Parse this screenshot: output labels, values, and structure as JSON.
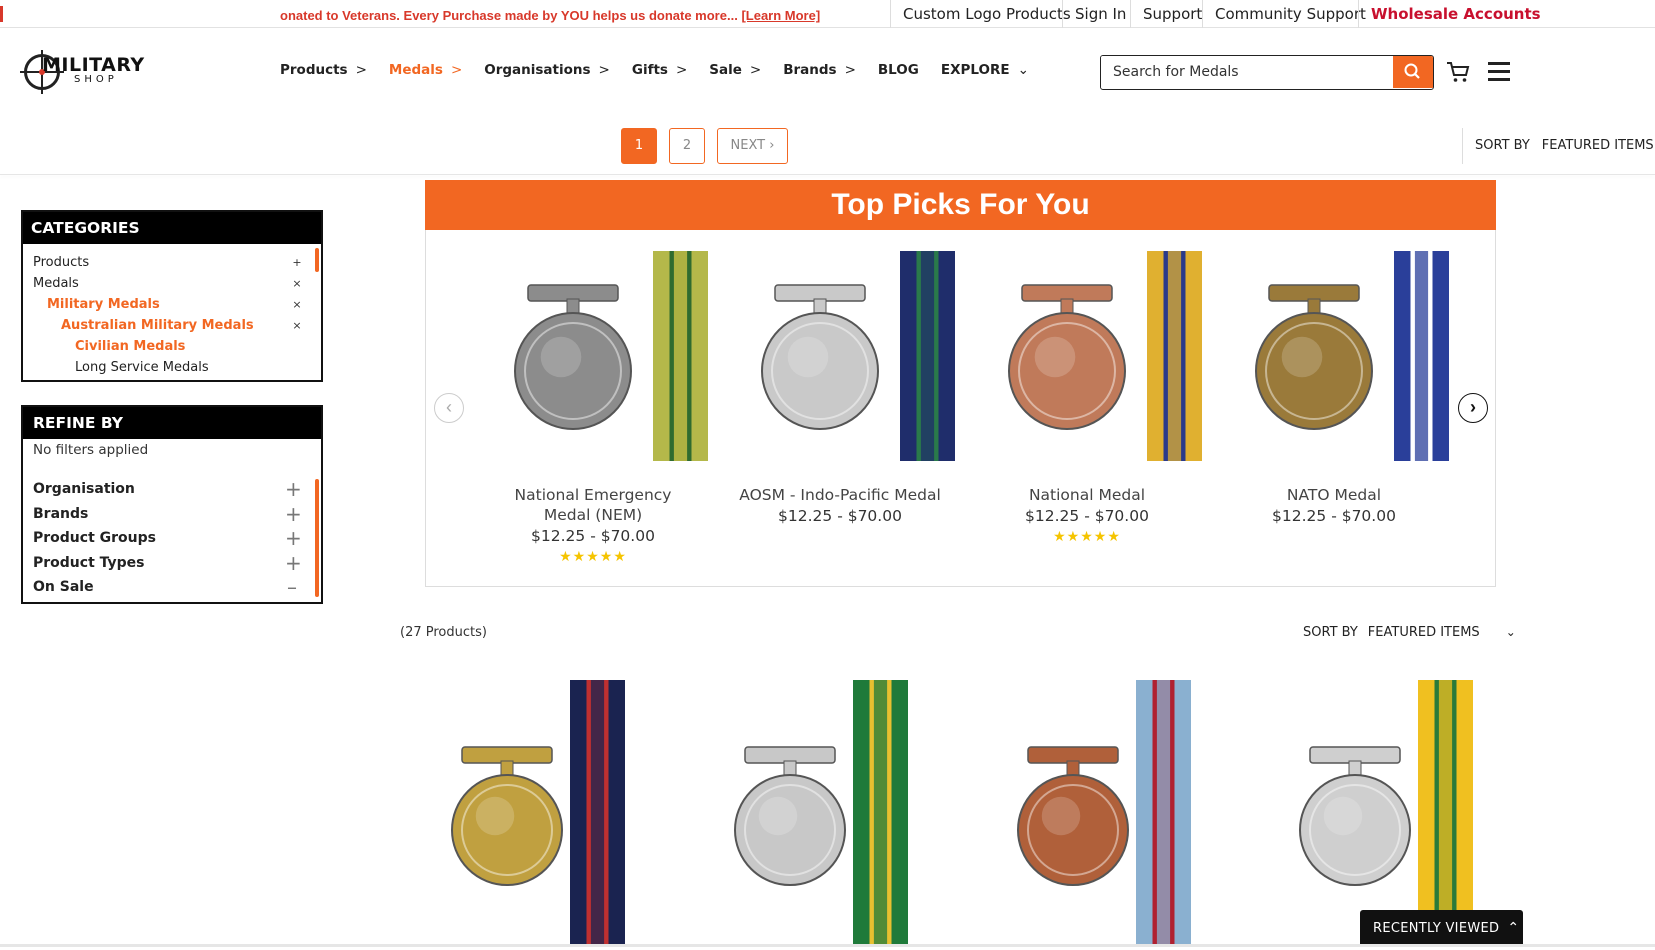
{
  "announcement": {
    "text": "onated to Veterans. Every Purchase made by YOU helps us donate more...",
    "link": "[Learn More]"
  },
  "top_links": [
    "Custom Logo Products",
    "Sign In",
    "Support",
    "Community Support",
    "Wholesale Accounts"
  ],
  "logo": {
    "line1": "MILITARY",
    "line2": "SHOP"
  },
  "nav": [
    {
      "label": "Products",
      "arrow": ">"
    },
    {
      "label": "Medals",
      "arrow": ">",
      "active": true
    },
    {
      "label": "Organisations",
      "arrow": ">"
    },
    {
      "label": "Gifts",
      "arrow": ">"
    },
    {
      "label": "Sale",
      "arrow": ">"
    },
    {
      "label": "Brands",
      "arrow": ">"
    },
    {
      "label": "BLOG",
      "arrow": ""
    },
    {
      "label": "EXPLORE",
      "arrow": "⌄"
    }
  ],
  "search": {
    "placeholder": "Search for Medals",
    "icon": "search-icon"
  },
  "pagination": {
    "pages": [
      "1",
      "2"
    ],
    "current": "1",
    "next": "NEXT"
  },
  "sort": {
    "label": "SORT BY",
    "value": "FEATURED ITEMS"
  },
  "categories": {
    "title": "CATEGORIES",
    "items": [
      {
        "label": "Products",
        "control": "+"
      },
      {
        "label": "Medals",
        "control": "×"
      },
      {
        "label": "Military Medals",
        "control": "×"
      },
      {
        "label": "Australian Military Medals",
        "control": "×"
      },
      {
        "label": "Civilian Medals",
        "control": ""
      },
      {
        "label": "Long Service Medals",
        "control": ""
      }
    ]
  },
  "refine": {
    "title": "REFINE BY",
    "status": "No filters applied",
    "filters": [
      {
        "label": "Organisation",
        "control": "+"
      },
      {
        "label": "Brands",
        "control": "+"
      },
      {
        "label": "Product Groups",
        "control": "+"
      },
      {
        "label": "Product Types",
        "control": "+"
      },
      {
        "label": "On Sale",
        "control": "–"
      }
    ]
  },
  "top_picks": {
    "title": "Top Picks For You",
    "products": [
      {
        "name": "National Emergency Medal (NEM)",
        "price": "$12.25 - $70.00",
        "stars": "★★★★★",
        "medal_color": "#8c8c8c",
        "ribbon": [
          "#b4b84a",
          "#2f6b2f",
          "#d8c84a"
        ]
      },
      {
        "name": "AOSM - Indo-Pacific Medal",
        "price": "$12.25 - $70.00",
        "stars": "",
        "medal_color": "#c9c9c9",
        "ribbon": [
          "#1f2d6b",
          "#2a7a4a",
          "#1f2d6b"
        ]
      },
      {
        "name": "National Medal",
        "price": "$12.25 - $70.00",
        "stars": "★★★★★",
        "medal_color": "#c07a5a",
        "ribbon": [
          "#e0b030",
          "#2a3a8a",
          "#e0b030"
        ]
      },
      {
        "name": "NATO Medal",
        "price": "$12.25 - $70.00",
        "stars": "",
        "medal_color": "#9a7a3a",
        "ribbon": [
          "#2a3f9a",
          "#ffffff",
          "#2a3f9a"
        ]
      }
    ]
  },
  "product_count": "(27 Products)",
  "listing": [
    {
      "medal_color": "#c0a040",
      "ribbon": [
        "#1a2350",
        "#c03030",
        "#1a2350"
      ]
    },
    {
      "medal_color": "#c8c8c8",
      "ribbon": [
        "#1f7a3a",
        "#e8c030",
        "#1f7a3a"
      ]
    },
    {
      "medal_color": "#b0603a",
      "ribbon": [
        "#8ab0d0",
        "#b02030",
        "#8ab0d0"
      ]
    },
    {
      "medal_color": "#cfcfcf",
      "ribbon": [
        "#f0c020",
        "#2a7a3a",
        "#f0c020"
      ]
    }
  ],
  "recently_viewed": "RECENTLY VIEWED",
  "colors": {
    "accent": "#f26722",
    "alert": "#d8382a",
    "wholesale": "#c8102e"
  }
}
